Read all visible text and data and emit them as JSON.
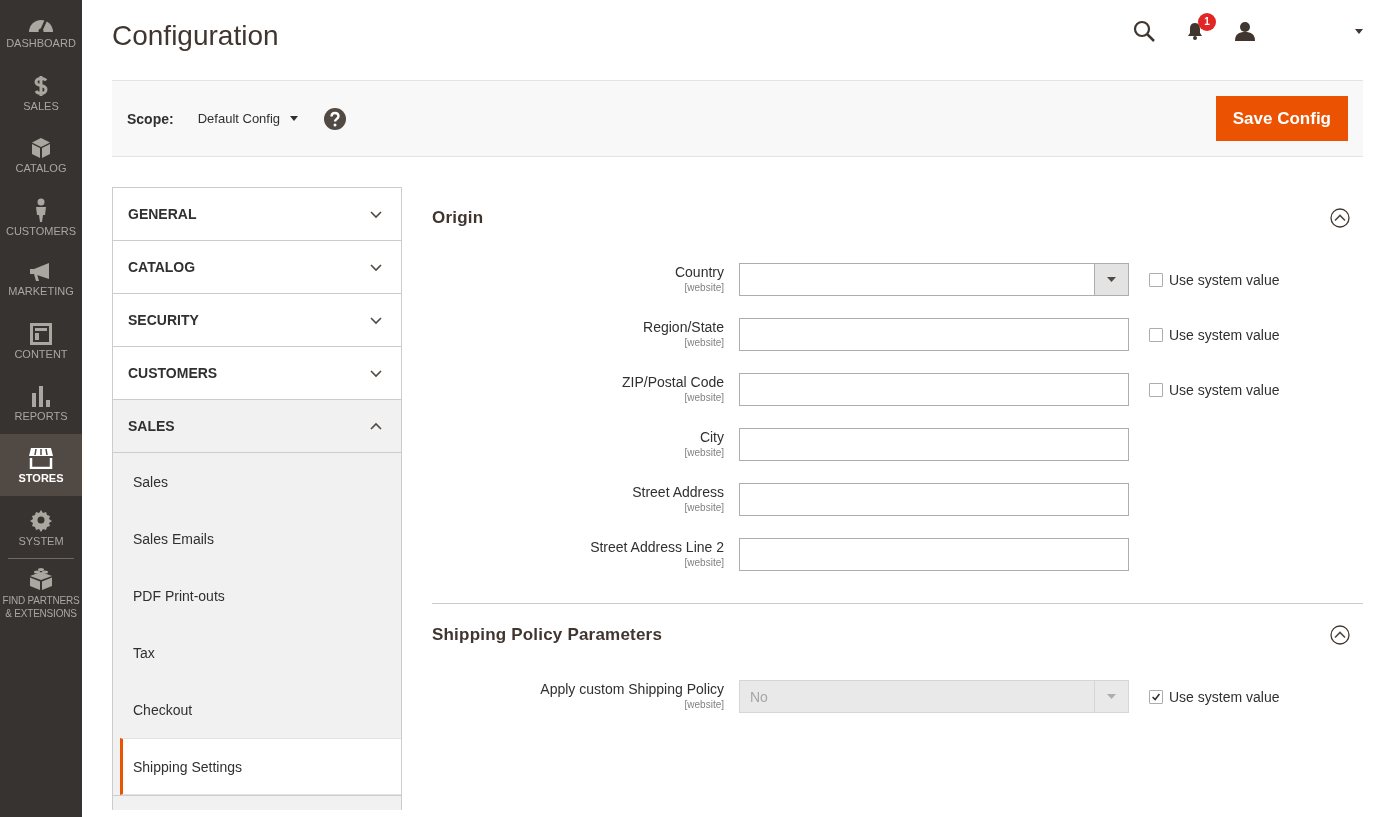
{
  "menu": [
    {
      "label": "DASHBOARD",
      "selected": false
    },
    {
      "label": "SALES",
      "selected": false
    },
    {
      "label": "CATALOG",
      "selected": false
    },
    {
      "label": "CUSTOMERS",
      "selected": false
    },
    {
      "label": "MARKETING",
      "selected": false
    },
    {
      "label": "CONTENT",
      "selected": false
    },
    {
      "label": "REPORTS",
      "selected": false
    },
    {
      "label": "STORES",
      "selected": true
    },
    {
      "label": "SYSTEM",
      "selected": false
    },
    {
      "label": "FIND PARTNERS & EXTENSIONS",
      "selected": false
    }
  ],
  "page": {
    "title": "Configuration",
    "notifications": "1"
  },
  "scope": {
    "label": "Scope:",
    "value": "Default Config"
  },
  "save_button": "Save Config",
  "tabs": [
    {
      "label": "GENERAL",
      "expanded": false
    },
    {
      "label": "CATALOG",
      "expanded": false
    },
    {
      "label": "SECURITY",
      "expanded": false
    },
    {
      "label": "CUSTOMERS",
      "expanded": false
    },
    {
      "label": "SALES",
      "expanded": true,
      "children": [
        {
          "label": "Sales",
          "selected": false
        },
        {
          "label": "Sales Emails",
          "selected": false
        },
        {
          "label": "PDF Print-outs",
          "selected": false
        },
        {
          "label": "Tax",
          "selected": false
        },
        {
          "label": "Checkout",
          "selected": false
        },
        {
          "label": "Shipping Settings",
          "selected": true
        }
      ]
    }
  ],
  "sections": [
    {
      "title": "Origin",
      "expanded": true,
      "fields": [
        {
          "label": "Country",
          "scope": "[website]",
          "kind": "select",
          "disabled": false,
          "system_value": {
            "label": "Use system value",
            "checked": false
          }
        },
        {
          "label": "Region/State",
          "scope": "[website]",
          "kind": "text",
          "disabled": false,
          "system_value": {
            "label": "Use system value",
            "checked": false
          }
        },
        {
          "label": "ZIP/Postal Code",
          "scope": "[website]",
          "kind": "text",
          "disabled": false,
          "system_value": {
            "label": "Use system value",
            "checked": false
          }
        },
        {
          "label": "City",
          "scope": "[website]",
          "kind": "text",
          "disabled": false
        },
        {
          "label": "Street Address",
          "scope": "[website]",
          "kind": "text",
          "disabled": false
        },
        {
          "label": "Street Address Line 2",
          "scope": "[website]",
          "kind": "text",
          "disabled": false
        }
      ]
    },
    {
      "title": "Shipping Policy Parameters",
      "expanded": true,
      "fields": [
        {
          "label": "Apply custom Shipping Policy",
          "scope": "[website]",
          "kind": "select",
          "value": "No",
          "disabled": true,
          "system_value": {
            "label": "Use system value",
            "checked": true
          }
        }
      ]
    }
  ]
}
